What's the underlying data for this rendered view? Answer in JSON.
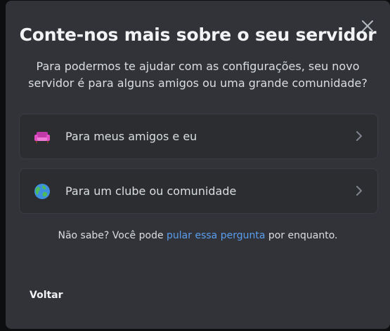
{
  "modal": {
    "title": "Conte-nos mais sobre o seu servidor",
    "subtitle": "Para podermos te ajudar com as configurações, seu novo servidor é para alguns amigos ou uma grande comunidade?",
    "close_icon": "close-icon",
    "options": [
      {
        "label": "Para meus amigos e eu",
        "icon": "couch-emoji-icon"
      },
      {
        "label": "Para um clube ou comunidade",
        "icon": "globe-emoji-icon"
      }
    ],
    "skip": {
      "prefix": "Não sabe? Você pode ",
      "link": "pular essa pergunta",
      "suffix": " por enquanto."
    },
    "back_label": "Voltar"
  },
  "colors": {
    "modal_bg": "#313338",
    "option_bg": "#2b2d31",
    "link": "#5a9eef",
    "text": "#dbdee1",
    "heading": "#f2f3f5"
  }
}
